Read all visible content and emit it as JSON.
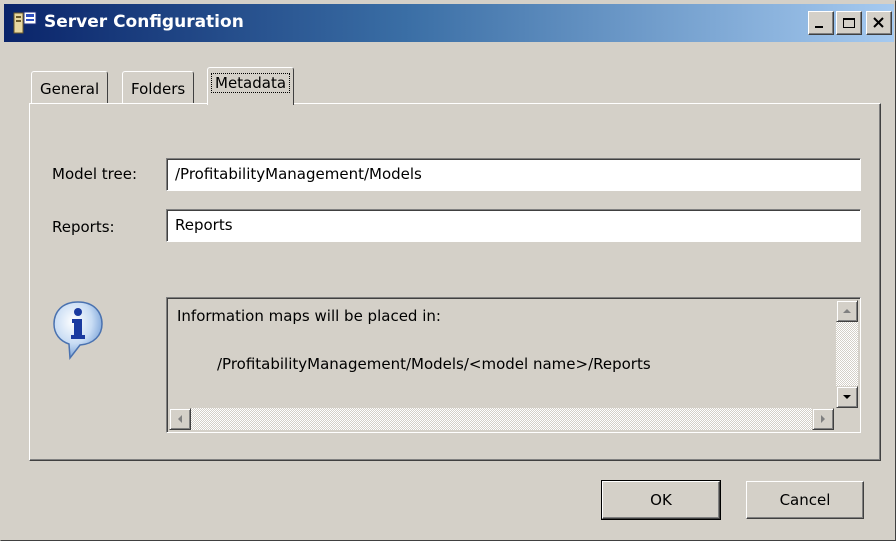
{
  "window": {
    "title": "Server Configuration"
  },
  "tabs": [
    {
      "label": "General"
    },
    {
      "label": "Folders"
    },
    {
      "label": "Metadata"
    }
  ],
  "form": {
    "model_tree": {
      "label": "Model tree:",
      "value": "/ProfitabilityManagement/Models"
    },
    "reports": {
      "label": "Reports:",
      "value": "Reports"
    }
  },
  "info": {
    "line1": "Information maps will be placed in:",
    "line2": "/ProfitabilityManagement/Models/<model name>/Reports"
  },
  "buttons": {
    "ok": "OK",
    "cancel": "Cancel"
  },
  "colors": {
    "titlebar_start": "#0a246a",
    "titlebar_end": "#a6caf0",
    "face": "#d4d0c8"
  },
  "icons": [
    "app-icon",
    "minimize-icon",
    "maximize-icon",
    "close-icon",
    "information-icon",
    "arrow-up-icon",
    "arrow-down-icon",
    "arrow-left-icon",
    "arrow-right-icon"
  ]
}
